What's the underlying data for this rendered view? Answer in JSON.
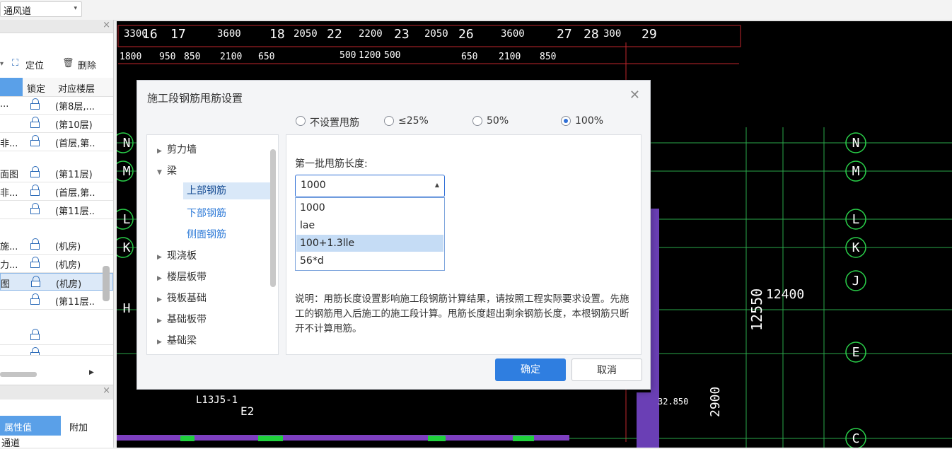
{
  "topbar": {
    "combo_value": "通风道"
  },
  "left_panel": {
    "toolbar": {
      "locate": "定位",
      "delete": "删除"
    },
    "columns": {
      "lock": "锁定",
      "floor": "对应楼层"
    },
    "rows": [
      {
        "name": "...",
        "floor": "(第8层,..."
      },
      {
        "name": "",
        "floor": "(第10层)"
      },
      {
        "name": "非...",
        "floor": "(首层,第.."
      },
      {
        "name": "",
        "floor": ""
      },
      {
        "name": "面图",
        "floor": "(第11层)"
      },
      {
        "name": "非...",
        "floor": "(首层,第.."
      },
      {
        "name": "",
        "floor": "(第11层.."
      },
      {
        "name": "",
        "floor": ""
      },
      {
        "name": "施...",
        "floor": "(机房)"
      },
      {
        "name": "力...",
        "floor": "(机房)"
      },
      {
        "name": "图",
        "floor": "(机房)"
      },
      {
        "name": "",
        "floor": "(第11层.."
      },
      {
        "name": "",
        "floor": ""
      },
      {
        "name": "",
        "floor": ""
      }
    ],
    "props": {
      "value_header": "属性值",
      "extra_header": "附加",
      "first_value": "通道"
    }
  },
  "dialog": {
    "title": "施工段钢筋甩筋设置",
    "radios": [
      {
        "label": "不设置甩筋",
        "checked": false
      },
      {
        "label": "≤25%",
        "checked": false
      },
      {
        "label": "50%",
        "checked": false
      },
      {
        "label": "100%",
        "checked": true
      }
    ],
    "tree": [
      {
        "label": "剪力墙",
        "expanded": false
      },
      {
        "label": "梁",
        "expanded": true,
        "children": [
          "上部钢筋",
          "下部钢筋",
          "侧面钢筋"
        ]
      },
      {
        "label": "现浇板",
        "expanded": false
      },
      {
        "label": "楼层板带",
        "expanded": false
      },
      {
        "label": "筏板基础",
        "expanded": false
      },
      {
        "label": "基础板带",
        "expanded": false
      },
      {
        "label": "基础梁",
        "expanded": false
      }
    ],
    "length_label": "第一批甩筋长度:",
    "length_value": "1000",
    "length_options": [
      "1000",
      "lae",
      "100+1.3lle",
      "56*d"
    ],
    "note": "说明：用筋长度设置影响施工段钢筋计算结果，请按照工程实际要求设置。先施工的钢筋甩入后施工的施工段计算。甩筋长度超出剩余钢筋长度，本根钢筋只断开不计算甩筋。",
    "ok": "确定",
    "cancel": "取消"
  },
  "cad": {
    "top_dims": [
      "3300",
      "3600",
      "2050",
      "2200",
      "2050",
      "3600",
      "300"
    ],
    "axis_top": [
      "16",
      "17",
      "18",
      "22",
      "23",
      "26",
      "27",
      "28",
      "29"
    ],
    "second_dims": [
      "1800",
      "950",
      "850",
      "2100",
      "650",
      "500",
      "1200",
      "500",
      "650",
      "2100",
      "850"
    ],
    "axis_right": [
      "N",
      "M",
      "L",
      "K",
      "J",
      "E",
      "C"
    ],
    "axis_left": [
      "N",
      "M",
      "L",
      "K",
      "H"
    ],
    "label_beam": "L13J5-1",
    "label_tag": "E2",
    "label_12400": "12400",
    "label_12550": "12550",
    "label_32850": "32.850",
    "label_2900": "2900"
  }
}
